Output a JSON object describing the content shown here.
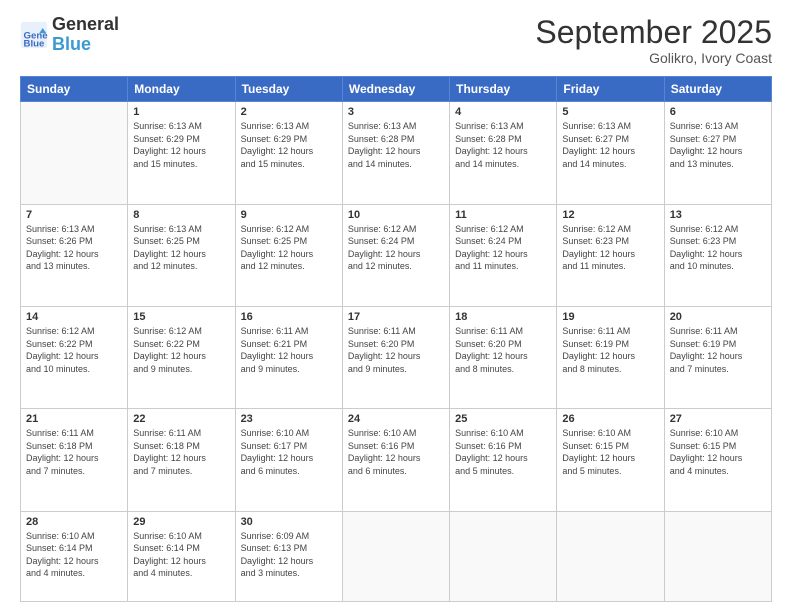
{
  "header": {
    "logo_line1": "General",
    "logo_line2": "Blue",
    "title": "September 2025",
    "subtitle": "Golikro, Ivory Coast"
  },
  "weekdays": [
    "Sunday",
    "Monday",
    "Tuesday",
    "Wednesday",
    "Thursday",
    "Friday",
    "Saturday"
  ],
  "weeks": [
    [
      {
        "day": "",
        "info": ""
      },
      {
        "day": "1",
        "info": "Sunrise: 6:13 AM\nSunset: 6:29 PM\nDaylight: 12 hours\nand 15 minutes."
      },
      {
        "day": "2",
        "info": "Sunrise: 6:13 AM\nSunset: 6:29 PM\nDaylight: 12 hours\nand 15 minutes."
      },
      {
        "day": "3",
        "info": "Sunrise: 6:13 AM\nSunset: 6:28 PM\nDaylight: 12 hours\nand 14 minutes."
      },
      {
        "day": "4",
        "info": "Sunrise: 6:13 AM\nSunset: 6:28 PM\nDaylight: 12 hours\nand 14 minutes."
      },
      {
        "day": "5",
        "info": "Sunrise: 6:13 AM\nSunset: 6:27 PM\nDaylight: 12 hours\nand 14 minutes."
      },
      {
        "day": "6",
        "info": "Sunrise: 6:13 AM\nSunset: 6:27 PM\nDaylight: 12 hours\nand 13 minutes."
      }
    ],
    [
      {
        "day": "7",
        "info": "Sunrise: 6:13 AM\nSunset: 6:26 PM\nDaylight: 12 hours\nand 13 minutes."
      },
      {
        "day": "8",
        "info": "Sunrise: 6:13 AM\nSunset: 6:25 PM\nDaylight: 12 hours\nand 12 minutes."
      },
      {
        "day": "9",
        "info": "Sunrise: 6:12 AM\nSunset: 6:25 PM\nDaylight: 12 hours\nand 12 minutes."
      },
      {
        "day": "10",
        "info": "Sunrise: 6:12 AM\nSunset: 6:24 PM\nDaylight: 12 hours\nand 12 minutes."
      },
      {
        "day": "11",
        "info": "Sunrise: 6:12 AM\nSunset: 6:24 PM\nDaylight: 12 hours\nand 11 minutes."
      },
      {
        "day": "12",
        "info": "Sunrise: 6:12 AM\nSunset: 6:23 PM\nDaylight: 12 hours\nand 11 minutes."
      },
      {
        "day": "13",
        "info": "Sunrise: 6:12 AM\nSunset: 6:23 PM\nDaylight: 12 hours\nand 10 minutes."
      }
    ],
    [
      {
        "day": "14",
        "info": "Sunrise: 6:12 AM\nSunset: 6:22 PM\nDaylight: 12 hours\nand 10 minutes."
      },
      {
        "day": "15",
        "info": "Sunrise: 6:12 AM\nSunset: 6:22 PM\nDaylight: 12 hours\nand 9 minutes."
      },
      {
        "day": "16",
        "info": "Sunrise: 6:11 AM\nSunset: 6:21 PM\nDaylight: 12 hours\nand 9 minutes."
      },
      {
        "day": "17",
        "info": "Sunrise: 6:11 AM\nSunset: 6:20 PM\nDaylight: 12 hours\nand 9 minutes."
      },
      {
        "day": "18",
        "info": "Sunrise: 6:11 AM\nSunset: 6:20 PM\nDaylight: 12 hours\nand 8 minutes."
      },
      {
        "day": "19",
        "info": "Sunrise: 6:11 AM\nSunset: 6:19 PM\nDaylight: 12 hours\nand 8 minutes."
      },
      {
        "day": "20",
        "info": "Sunrise: 6:11 AM\nSunset: 6:19 PM\nDaylight: 12 hours\nand 7 minutes."
      }
    ],
    [
      {
        "day": "21",
        "info": "Sunrise: 6:11 AM\nSunset: 6:18 PM\nDaylight: 12 hours\nand 7 minutes."
      },
      {
        "day": "22",
        "info": "Sunrise: 6:11 AM\nSunset: 6:18 PM\nDaylight: 12 hours\nand 7 minutes."
      },
      {
        "day": "23",
        "info": "Sunrise: 6:10 AM\nSunset: 6:17 PM\nDaylight: 12 hours\nand 6 minutes."
      },
      {
        "day": "24",
        "info": "Sunrise: 6:10 AM\nSunset: 6:16 PM\nDaylight: 12 hours\nand 6 minutes."
      },
      {
        "day": "25",
        "info": "Sunrise: 6:10 AM\nSunset: 6:16 PM\nDaylight: 12 hours\nand 5 minutes."
      },
      {
        "day": "26",
        "info": "Sunrise: 6:10 AM\nSunset: 6:15 PM\nDaylight: 12 hours\nand 5 minutes."
      },
      {
        "day": "27",
        "info": "Sunrise: 6:10 AM\nSunset: 6:15 PM\nDaylight: 12 hours\nand 4 minutes."
      }
    ],
    [
      {
        "day": "28",
        "info": "Sunrise: 6:10 AM\nSunset: 6:14 PM\nDaylight: 12 hours\nand 4 minutes."
      },
      {
        "day": "29",
        "info": "Sunrise: 6:10 AM\nSunset: 6:14 PM\nDaylight: 12 hours\nand 4 minutes."
      },
      {
        "day": "30",
        "info": "Sunrise: 6:09 AM\nSunset: 6:13 PM\nDaylight: 12 hours\nand 3 minutes."
      },
      {
        "day": "",
        "info": ""
      },
      {
        "day": "",
        "info": ""
      },
      {
        "day": "",
        "info": ""
      },
      {
        "day": "",
        "info": ""
      }
    ]
  ]
}
